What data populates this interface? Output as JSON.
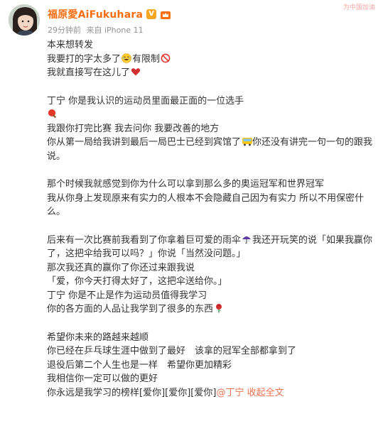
{
  "post": {
    "username": "福原愛AiFukuhara",
    "time": "29分钟前",
    "source": "来自 iPhone 11",
    "corner": "为中国加油"
  },
  "body": {
    "l1": "本来想转发",
    "l2a": "我要打的字太多了",
    "l2b": "有限制",
    "l3": "我就直接写在这儿了",
    "l4": "丁宁 你是我认识的运动员里面最正面的一位选手",
    "l6": "我跟你打完比赛 我去问你 我要改善的地方",
    "l7a": "你从第一局给我讲到最后一局巴士已经到宾馆了",
    "l7b": "你还没有讲完一句一句的跟我",
    "l8": "说。",
    "l9": "那个时候我就感觉到你为什么可以拿到那么多的奥运冠军和世界冠军",
    "l10": "我从你身上发现原来有实力的人根本不会隐藏自己因为有实力 所以不用保密什",
    "l11": "么。",
    "l12a": "后来有一次比赛前我看到了你拿着巨可爱的雨伞",
    "l12b": "我还开玩笑的说「如果我赢你",
    "l13": "了，这把伞给我可以吗？」你说「当然没问题。」",
    "l14": "那次我还真的赢你了你还过来跟我说",
    "l15": "「爱，你今天打得太好了，这把伞送给你。」",
    "l16": "丁宁 你是不止是作为运动员值得我学习",
    "l17": "你的各方面的人品让我学到了很多的东西",
    "l18": "希望你未来的路越来越顺",
    "l19": "你已经在乒乓球生涯中做到了最好　该拿的冠军全部都拿到了",
    "l20": "退役后第二个人生也是一样　希望你更加精彩",
    "l21": "我相信你一定可以做的更好",
    "l22a": "你永远是我学习的榜样[爱你][爱你][爱你]",
    "l22b": "@丁宁",
    "l22c": "收起全文"
  },
  "colors": {
    "username": "#f86d0e",
    "link": "#eb7350",
    "text": "#333333",
    "meta": "#939393"
  }
}
